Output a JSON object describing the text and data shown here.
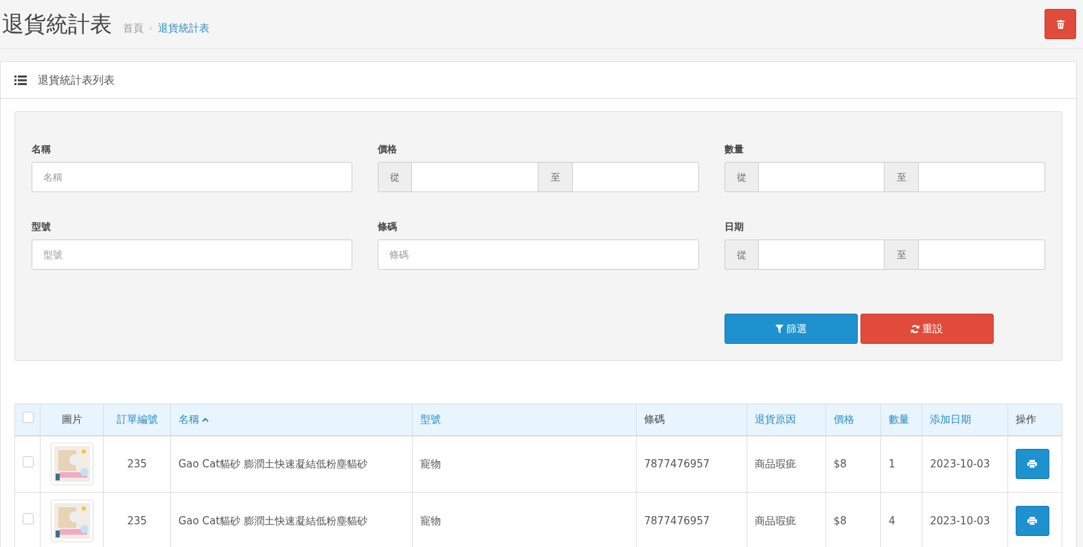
{
  "page": {
    "title": "退貨統計表",
    "breadcrumb_separator": "›",
    "breadcrumb": [
      {
        "label": "首頁",
        "selected": false
      },
      {
        "label": "退貨統計表",
        "selected": true
      }
    ]
  },
  "panel": {
    "title": "退貨統計表列表"
  },
  "filters": [
    {
      "kind": "text",
      "label": "名稱",
      "placeholder": "名稱"
    },
    {
      "kind": "range",
      "label": "價格",
      "from": "從",
      "to": "至"
    },
    {
      "kind": "range",
      "label": "數量",
      "from": "從",
      "to": "至"
    },
    {
      "kind": "text",
      "label": "型號",
      "placeholder": "型號"
    },
    {
      "kind": "text",
      "label": "條碼",
      "placeholder": "條碼"
    },
    {
      "kind": "range",
      "label": "日期",
      "from": "從",
      "to": "至"
    }
  ],
  "filter_buttons": [
    {
      "kind": "filter",
      "label": "篩選"
    },
    {
      "kind": "reset",
      "label": "重設"
    }
  ],
  "table": {
    "select_all_checked": false,
    "columns": [
      {
        "label": "圖片",
        "sortable": false,
        "sorted": false
      },
      {
        "label": "訂單編號",
        "sortable": true,
        "sorted": false
      },
      {
        "label": "名稱",
        "sortable": true,
        "sorted": true
      },
      {
        "label": "型號",
        "sortable": true,
        "sorted": false
      },
      {
        "label": "條碼",
        "sortable": false,
        "sorted": false
      },
      {
        "label": "退貨原因",
        "sortable": true,
        "sorted": false
      },
      {
        "label": "價格",
        "sortable": true,
        "sorted": false
      },
      {
        "label": "數量",
        "sortable": true,
        "sorted": false
      },
      {
        "label": "添加日期",
        "sortable": true,
        "sorted": false
      },
      {
        "label": "操作",
        "sortable": false,
        "sorted": false
      }
    ],
    "rows": [
      {
        "checked": false,
        "order": "235",
        "name": "Gao Cat貓砂 膨潤土快速凝結低粉塵貓砂",
        "model": "寵物",
        "barcode": "7877476957",
        "reason": "商品瑕疵",
        "price": "$8",
        "quantity": "1",
        "date": "2023-10-03"
      },
      {
        "checked": false,
        "order": "235",
        "name": "Gao Cat貓砂 膨潤土快速凝結低粉塵貓砂",
        "model": "寵物",
        "barcode": "7877476957",
        "reason": "商品瑕疵",
        "price": "$8",
        "quantity": "4",
        "date": "2023-10-03"
      }
    ]
  }
}
